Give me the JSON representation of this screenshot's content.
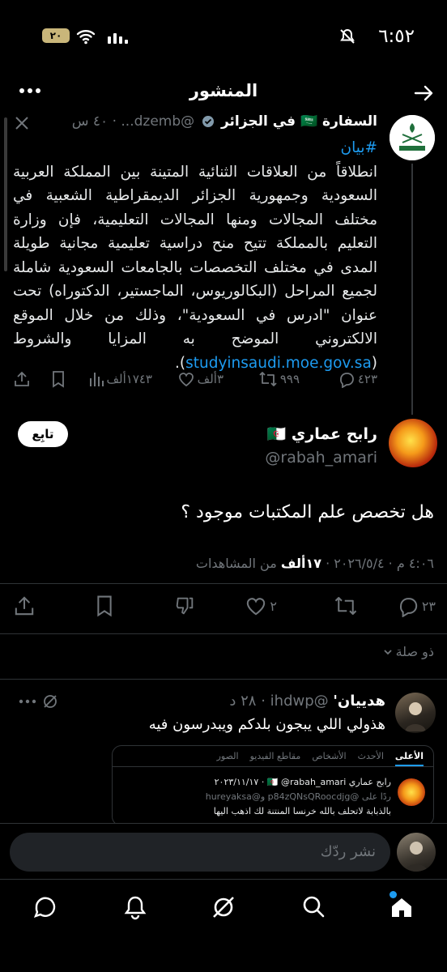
{
  "status_bar": {
    "time": "٦:٥٢",
    "battery": "٢٠"
  },
  "header": {
    "title": "المنشور"
  },
  "quoted_tweet": {
    "author_name": "السفارة 🇸🇦 في الجزائر",
    "handle_time": "@dzemb... · ٤٠ س",
    "hashtag": "#بيان",
    "text": "انطلاقاً من العلاقات الثنائية المتينة بين المملكة العربية السعودية وجمهورية الجزائر الديمقراطية الشعبية في مختلف المجالات ومنها المجالات التعليمية، فإن وزارة التعليم بالمملكة تتيح منح دراسية تعليمية مجانية طويلة المدى في مختلف التخصصات بالجامعات السعودية شاملة لجميع المراحل (البكالوريوس، الماجستير، الدكتوراه) تحت عنوان \"ادرس في السعودية\"، وذلك من خلال الموقع الالكتروني الموضح به المزايا والشروط (",
    "link": "studyinsaudi.moe.gov.sa",
    "text_end": ").",
    "replies": "٤٢٣",
    "reposts": "٩٩٩",
    "likes": "٣ألف",
    "views": "١٧٤٣ألف"
  },
  "main_tweet": {
    "author_name": "رابح عماري 🇩🇿",
    "handle": "@rabah_amari",
    "follow_label": "تابِع",
    "text": "هل تخصص علم المكتبات موجود ؟",
    "timestamp": "٤:٠٦ م · ٢٠٢٦/٥/٤ ·",
    "views_count": "١٧ألف",
    "views_label": "من المشاهدات",
    "replies": "٢٣",
    "likes": "٢"
  },
  "related_label": "ذو صلة",
  "reply_tweet": {
    "author_name": "هدييان'",
    "handle_time": "@ihdwp · ٢٨ د",
    "text": "هذولي اللي يبجون بلدكم ويبدرسون فيه",
    "embed": {
      "tabs": [
        "الأعلى",
        "الأحدث",
        "الأشخاص",
        "مقاطع الفيديو",
        "الصور"
      ],
      "author": "رابح عماري 🇩🇿 @rabah_amari · ٢٠٢٣/١١/١٧",
      "reply_to": "ردًا على @p84zQNsQRoocdjg و@hureyaksa",
      "text": "بالذبابة لاتحلف بالله خرنسا المنتنة لك اذهب اليها"
    }
  },
  "composer": {
    "placeholder": "نشر ردّك"
  },
  "colors": {
    "accent": "#1d9bf0",
    "background": "#000000",
    "text": "#e7e9ea",
    "muted": "#71767b"
  }
}
